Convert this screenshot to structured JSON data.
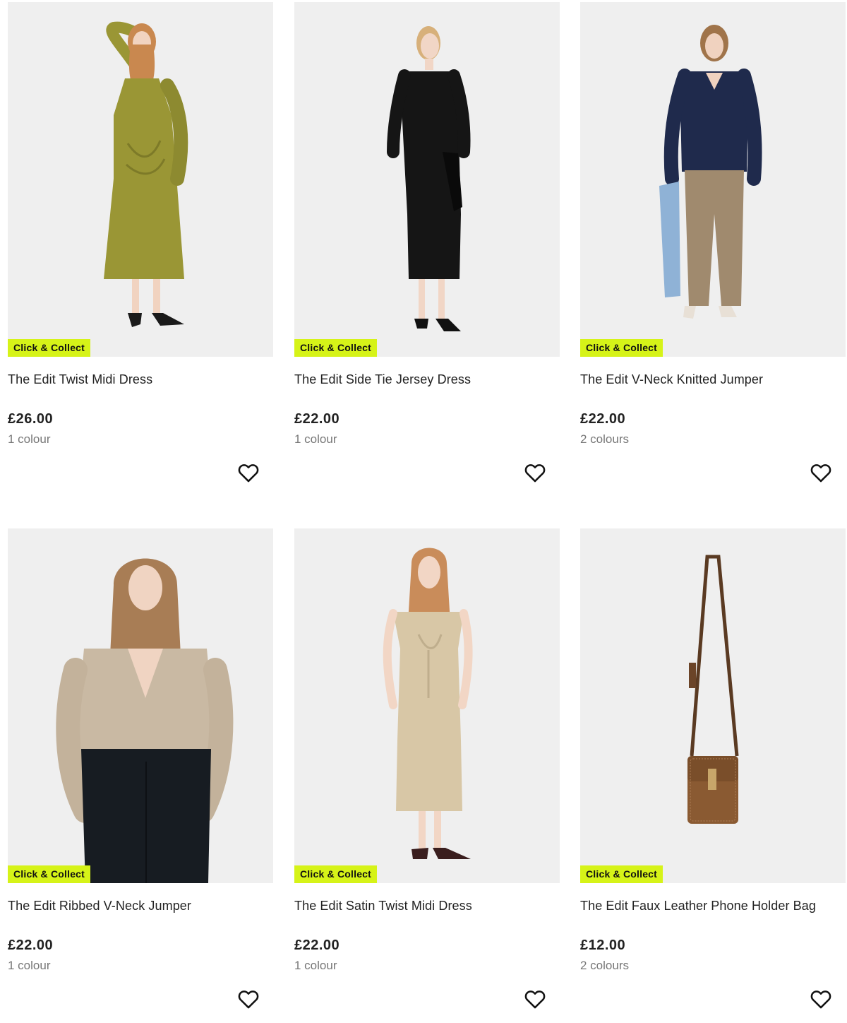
{
  "products": [
    {
      "name": "The Edit Twist Midi Dress",
      "price": "£26.00",
      "colours": "1 colour",
      "badge": "Click & Collect",
      "image": "woman-in-olive-twist-midi-dress",
      "garment_color": "#9a9635"
    },
    {
      "name": "The Edit Side Tie Jersey Dress",
      "price": "£22.00",
      "colours": "1 colour",
      "badge": "Click & Collect",
      "image": "woman-in-black-side-tie-dress",
      "garment_color": "#151515"
    },
    {
      "name": "The Edit V-Neck Knitted Jumper",
      "price": "£22.00",
      "colours": "2 colours",
      "badge": "Click & Collect",
      "image": "woman-in-navy-vneck-jumper",
      "garment_color": "#1f2a4c"
    },
    {
      "name": "The Edit Ribbed V-Neck Jumper",
      "price": "£22.00",
      "colours": "1 colour",
      "badge": "Click & Collect",
      "image": "woman-in-beige-ribbed-jumper",
      "garment_color": "#c9b9a3"
    },
    {
      "name": "The Edit Satin Twist Midi Dress",
      "price": "£22.00",
      "colours": "1 colour",
      "badge": "Click & Collect",
      "image": "woman-in-beige-satin-dress",
      "garment_color": "#d8c7a6"
    },
    {
      "name": "The Edit Faux Leather Phone Holder Bag",
      "price": "£12.00",
      "colours": "2 colours",
      "badge": "Click & Collect",
      "image": "tan-faux-leather-phone-bag",
      "garment_color": "#8a5a32"
    }
  ],
  "colors": {
    "badge_bg": "#d6f318",
    "image_bg": "#efefef",
    "text": "#222222",
    "muted": "#777777"
  },
  "icons": {
    "favourite": "heart-outline-icon"
  }
}
